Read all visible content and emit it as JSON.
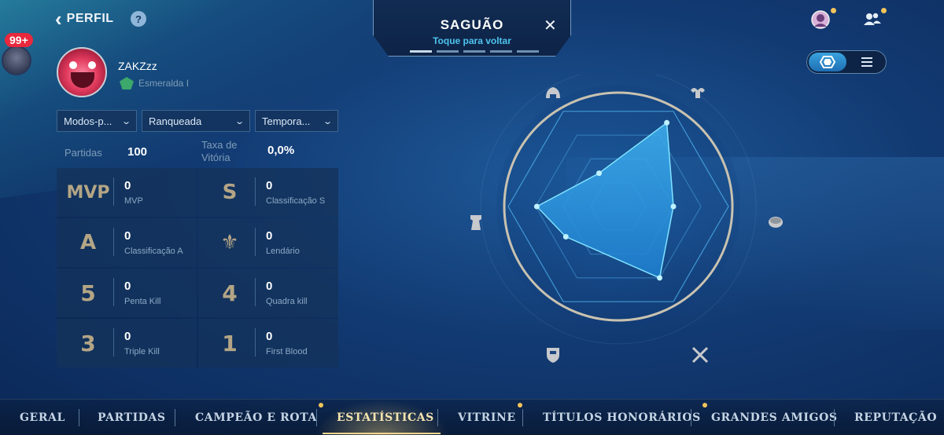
{
  "header": {
    "back_label": "PERFIL",
    "help_glyph": "?",
    "notification_badge": "99+"
  },
  "profile": {
    "name": "ZAKZzz",
    "rank": "Esmeralda I"
  },
  "filters": [
    {
      "label": "Modos-p...",
      "icon": "chevron-down-icon"
    },
    {
      "label": "Ranqueada",
      "icon": "chevron-down-icon"
    },
    {
      "label": "Tempora...",
      "icon": "chevron-down-icon"
    }
  ],
  "summary": {
    "matches_label": "Partidas",
    "matches_value": "100",
    "winrate_label_1": "Taxa de",
    "winrate_label_2": "Vitória",
    "winrate_value": "0,0%"
  },
  "stats": [
    {
      "glyph": "MVP",
      "value": "0",
      "label": "MVP"
    },
    {
      "glyph": "S",
      "value": "0",
      "label": "Classificação S"
    },
    {
      "glyph": "A",
      "value": "0",
      "label": "Classificação A"
    },
    {
      "glyph": "⚜",
      "value": "0",
      "label": "Lendário"
    },
    {
      "glyph": "5",
      "value": "0",
      "label": "Penta Kill"
    },
    {
      "glyph": "4",
      "value": "0",
      "label": "Quadra kill"
    },
    {
      "glyph": "3",
      "value": "0",
      "label": "Triple Kill"
    },
    {
      "glyph": "1",
      "value": "0",
      "label": "First Blood"
    }
  ],
  "lobby": {
    "title": "SAGUÃO",
    "subtitle": "Toque para voltar",
    "close_glyph": "✕"
  },
  "radar": {
    "axis_icons": [
      "helmet-icon",
      "ram-icon",
      "coin-icon",
      "swords-icon",
      "shield-icon",
      "tower-icon"
    ],
    "levels": [
      0.88,
      0.35,
      0.74,
      0.55,
      0.75,
      0.5
    ]
  },
  "nav": {
    "tabs": [
      {
        "label": "GERAL",
        "dot": false,
        "active": false
      },
      {
        "label": "PARTIDAS",
        "dot": false,
        "active": false
      },
      {
        "label": "CAMPEÃO E ROTA",
        "dot": true,
        "active": false
      },
      {
        "label": "ESTATÍSTICAS",
        "dot": false,
        "active": true
      },
      {
        "label": "VITRINE",
        "dot": true,
        "active": false
      },
      {
        "label": "TÍTULOS HONORÁRIOS",
        "dot": true,
        "active": false
      },
      {
        "label": "GRANDES AMIGOS",
        "dot": false,
        "active": false
      },
      {
        "label": "REPUTAÇÃO",
        "dot": false,
        "active": false
      }
    ]
  },
  "colors": {
    "accent_cyan": "#4ec3ee",
    "gold": "#f3c45a",
    "notification_red": "#e8283c",
    "rank_green": "#3ca86c"
  }
}
